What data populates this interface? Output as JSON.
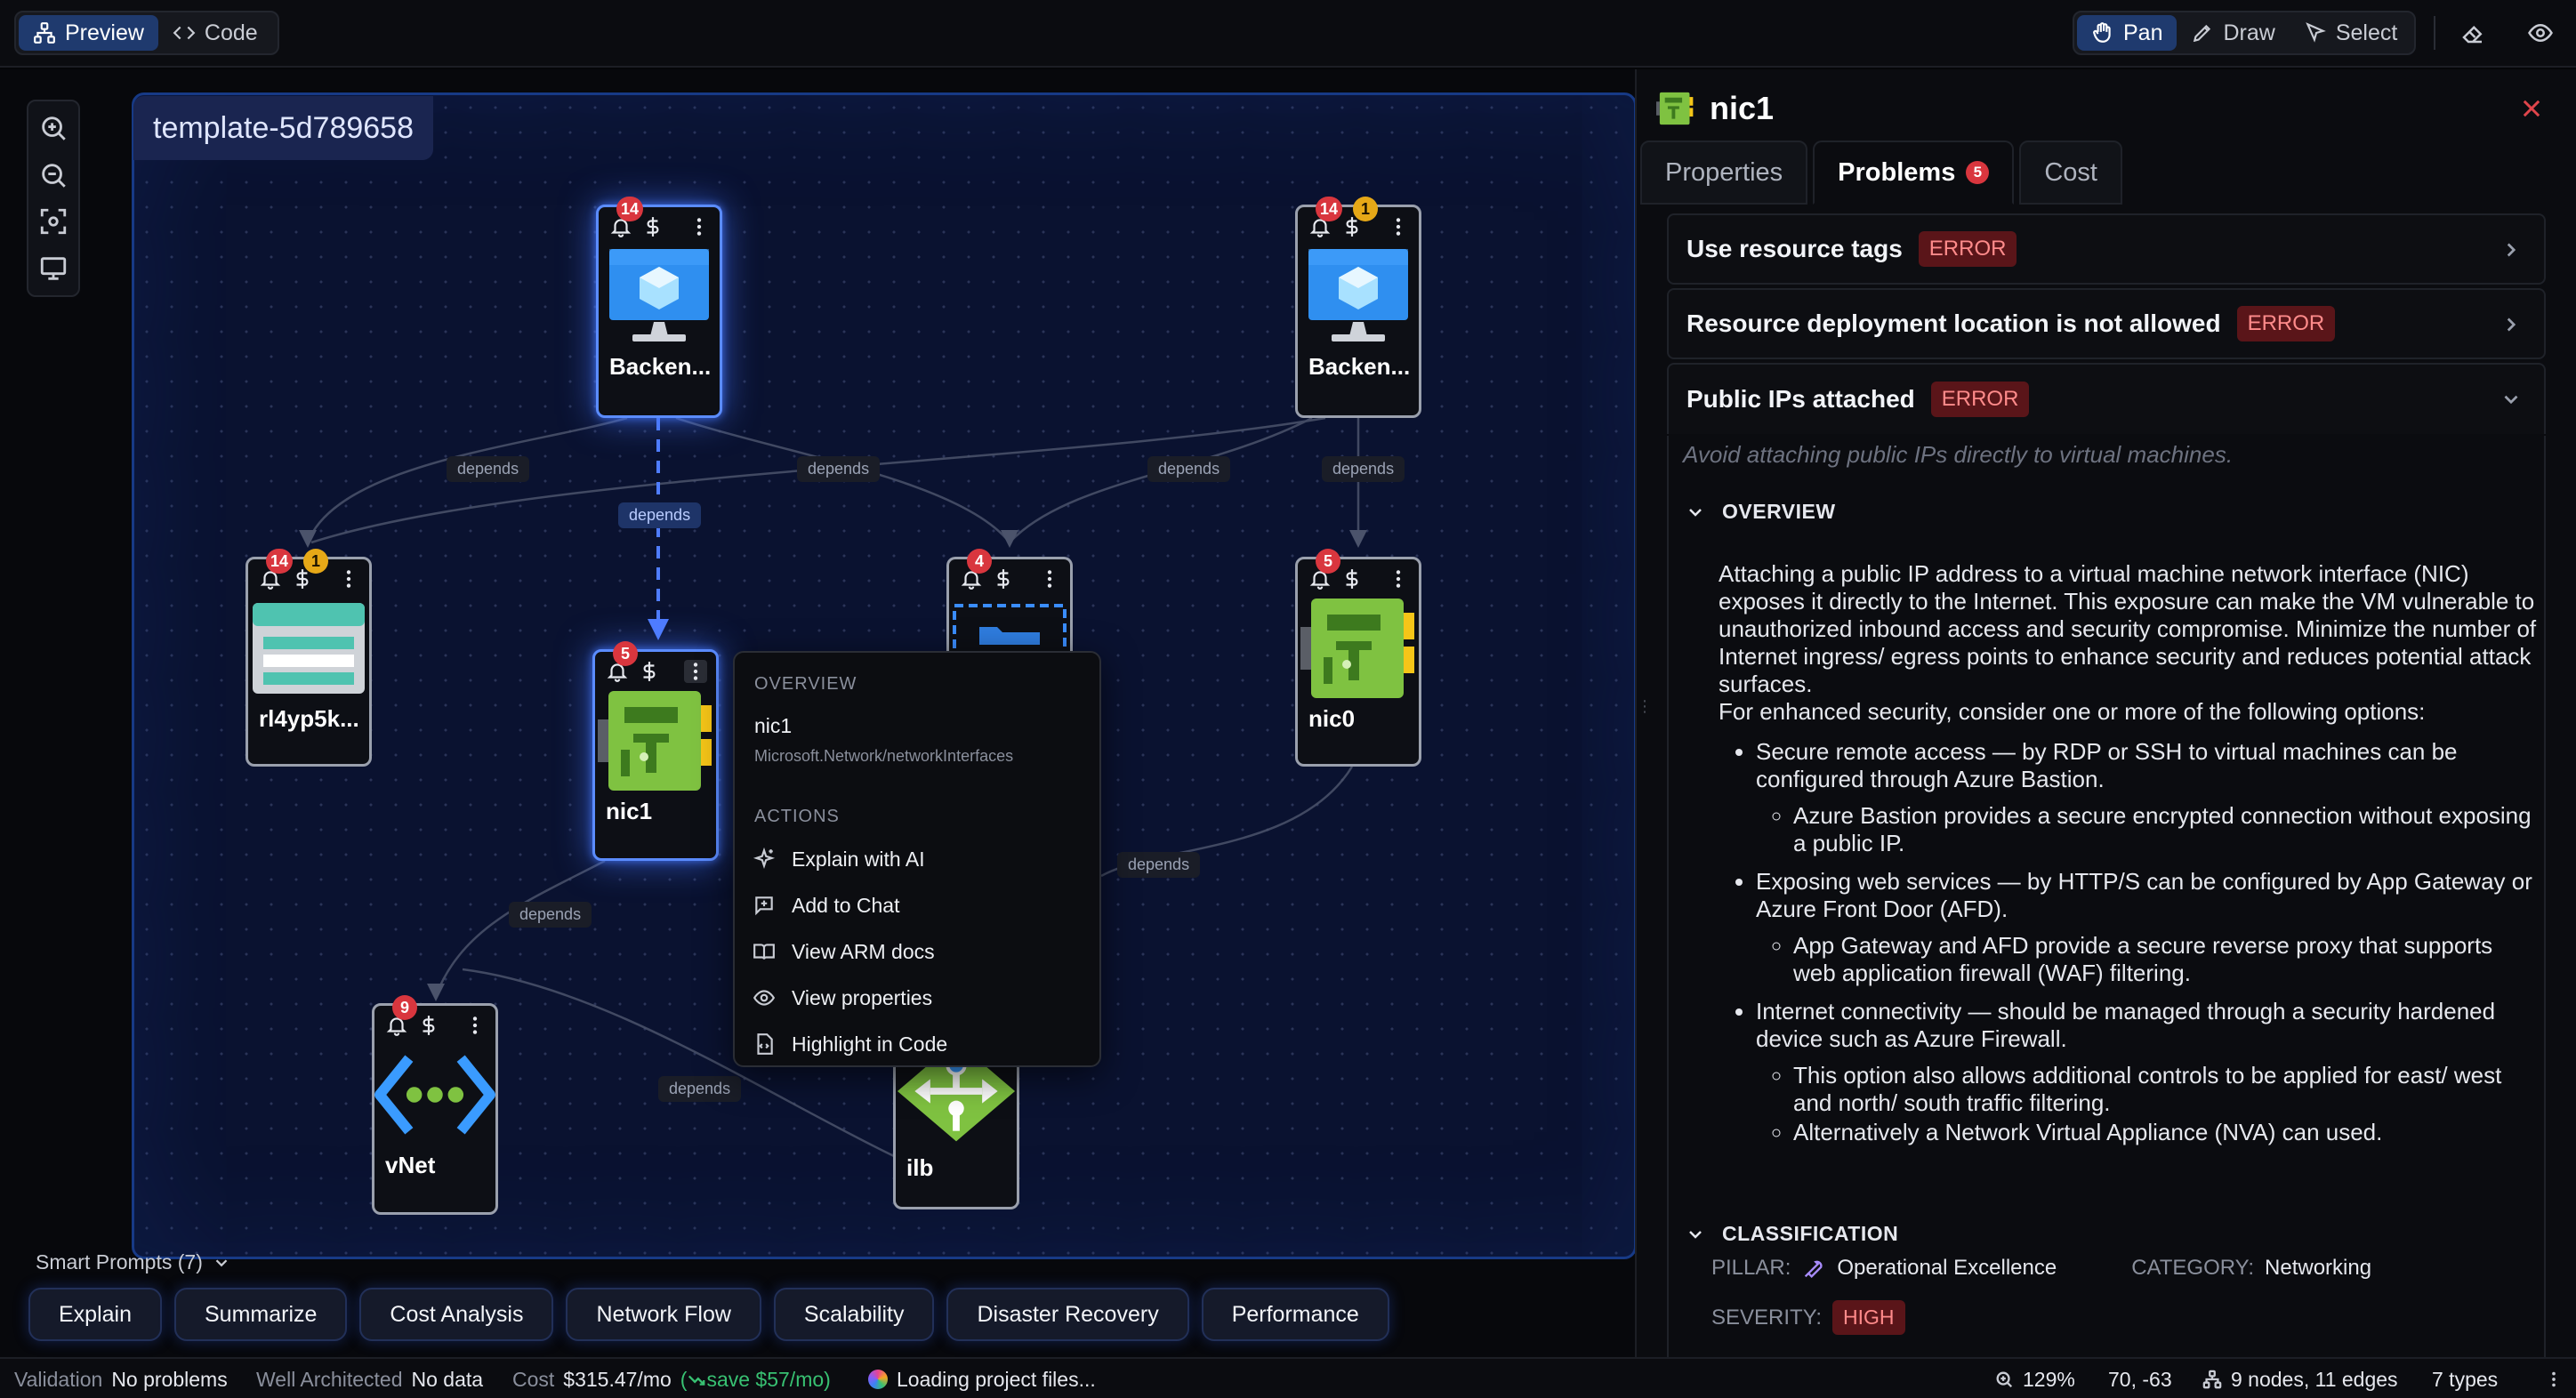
{
  "toolbar": {
    "preview_label": "Preview",
    "code_label": "Code",
    "pan_label": "Pan",
    "draw_label": "Draw",
    "select_label": "Select"
  },
  "canvas": {
    "template_name": "template-5d789658",
    "edge_label": "depends"
  },
  "nodes": {
    "backend1": {
      "label": "Backen...",
      "alerts": "14"
    },
    "backend2": {
      "label": "Backen...",
      "alerts": "14",
      "warnings": "1"
    },
    "rl4": {
      "label": "rl4yp5k...",
      "alerts": "14",
      "warnings": "1"
    },
    "nic1": {
      "label": "nic1",
      "alerts": "5"
    },
    "mid": {
      "alerts": "4"
    },
    "nic0": {
      "label": "nic0",
      "alerts": "5"
    },
    "vnet": {
      "label": "vNet",
      "alerts": "9"
    },
    "ilb": {
      "label": "ilb"
    }
  },
  "context_menu": {
    "overview_heading": "OVERVIEW",
    "resource_name": "nic1",
    "resource_type": "Microsoft.Network/networkInterfaces",
    "actions_heading": "ACTIONS",
    "items": [
      "Explain with AI",
      "Add to Chat",
      "View ARM docs",
      "View properties",
      "Highlight in Code"
    ]
  },
  "smart_prompts": {
    "title": "Smart Prompts (7)",
    "items": [
      "Explain",
      "Summarize",
      "Cost Analysis",
      "Network Flow",
      "Scalability",
      "Disaster Recovery",
      "Performance"
    ]
  },
  "status": {
    "validation_label": "Validation",
    "validation_value": "No problems",
    "wa_label": "Well Architected",
    "wa_value": "No data",
    "cost_label": "Cost",
    "cost_value": "$315.47/mo",
    "save_value": "save $57/mo",
    "loading": "Loading project files...",
    "zoom": "129%",
    "coords": "70, -63",
    "graph": "9 nodes, 11 edges",
    "types": "7 types"
  },
  "panel": {
    "title": "nic1",
    "tabs": {
      "properties": "Properties",
      "problems": "Problems",
      "problems_count": "5",
      "cost": "Cost"
    },
    "problems": [
      {
        "title": "Use resource tags",
        "level": "ERROR"
      },
      {
        "title": "Resource deployment location is not allowed",
        "level": "ERROR"
      },
      {
        "title": "Public IPs attached",
        "level": "ERROR"
      }
    ],
    "description": "Avoid attaching public IPs directly to virtual machines.",
    "overview_heading": "OVERVIEW",
    "overview_text": "Attaching a public IP address to a virtual machine network interface (NIC) exposes it directly to the Internet. This exposure can make the VM vulnerable to unauthorized inbound access and security compromise. Minimize the number of Internet ingress/ egress points to enhance security and reduces potential attack surfaces.",
    "overview_intro": "For enhanced security, consider one or more of the following options:",
    "bullets": [
      {
        "text": "Secure remote access — by RDP or SSH to virtual machines can be configured through Azure Bastion.",
        "sub": [
          "Azure Bastion provides a secure encrypted connection without exposing a public IP."
        ]
      },
      {
        "text": "Exposing web services — by HTTP/S can be configured by App Gateway or Azure Front Door (AFD).",
        "sub": [
          "App Gateway and AFD provide a secure reverse proxy that supports web application firewall (WAF) filtering."
        ]
      },
      {
        "text": "Internet connectivity — should be managed through a security hardened device such as Azure Firewall.",
        "sub": [
          "This option also allows additional controls to be applied for east/ west and north/ south traffic filtering.",
          "Alternatively a Network Virtual Appliance (NVA) can used."
        ]
      }
    ],
    "classification_heading": "CLASSIFICATION",
    "pillar_label": "PILLAR:",
    "pillar_value": "Operational Excellence",
    "category_label": "CATEGORY:",
    "category_value": "Networking",
    "severity_label": "SEVERITY:",
    "severity_value": "HIGH"
  },
  "colors": {
    "accent": "#1f3a6e",
    "selected_glow": "#5b8cff",
    "error": "#d9363e",
    "warning": "#e6a817",
    "save_green": "#38c172"
  }
}
